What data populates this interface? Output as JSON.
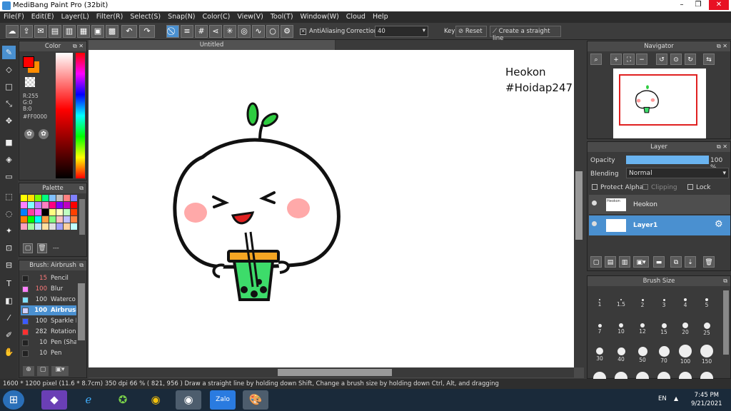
{
  "title_bar": {
    "title": "MediBang Paint Pro (32bit)",
    "minimize": "–",
    "restore": "❐",
    "close": "✕"
  },
  "menu": [
    "File(F)",
    "Edit(E)",
    "Layer(L)",
    "Filter(R)",
    "Select(S)",
    "Snap(N)",
    "Color(C)",
    "View(V)",
    "Tool(T)",
    "Window(W)",
    "Cloud",
    "Help"
  ],
  "toolbar": {
    "antialiasing_label": "AntiAliasing",
    "correction_label": "Correction",
    "correction_value": "40",
    "key_label": "Key",
    "reset_label": "Reset",
    "straight_line_label": "Create a straight line"
  },
  "color_panel": {
    "title": "Color",
    "r": "R:255",
    "g": "G:0",
    "b": "B:0",
    "hex": "#FF0000",
    "primary_color": "#ff0000",
    "secondary_color": "#ff8c00"
  },
  "palette_panel": {
    "title": "Palette",
    "footer_label": "---"
  },
  "brush_panel": {
    "title": "Brush: Airbrush",
    "items": [
      {
        "size": "15",
        "name": "Pencil",
        "color": "#222222",
        "num_color": "#ff7a7a"
      },
      {
        "size": "100",
        "name": "Blur",
        "color": "#ff80ff",
        "num_color": "#ff7a7a"
      },
      {
        "size": "100",
        "name": "Waterco",
        "color": "#80e0ff",
        "num_color": "#dddddd"
      },
      {
        "size": "100",
        "name": "Airbrush",
        "color": "#d0d0ff",
        "num_color": "#ffffff",
        "selected": true
      },
      {
        "size": "100",
        "name": "Sparkle B",
        "color": "#3a5aff",
        "num_color": "#dddddd"
      },
      {
        "size": "282",
        "name": "Rotation",
        "color": "#ff3030",
        "num_color": "#dddddd"
      },
      {
        "size": "10",
        "name": "Pen (Sha",
        "color": "#222222",
        "num_color": "#dddddd"
      },
      {
        "size": "10",
        "name": "Pen",
        "color": "#222222",
        "num_color": "#dddddd"
      }
    ]
  },
  "canvas": {
    "tab_title": "Untitled",
    "text_line1": "Heokon",
    "text_line2": "#Hoidap247"
  },
  "navigator": {
    "title": "Navigator"
  },
  "layer_panel": {
    "title": "Layer",
    "opacity_label": "Opacity",
    "opacity_value": "100 %",
    "opacity_percent": 100,
    "blending_label": "Blending",
    "blending_value": "Normal",
    "protect_alpha": "Protect Alpha",
    "clipping": "Clipping",
    "lock": "Lock",
    "layers": [
      {
        "name": "Heokon",
        "selected": false
      },
      {
        "name": "Layer1",
        "selected": true
      }
    ]
  },
  "brush_size": {
    "title": "Brush Size",
    "sizes": [
      "1",
      "1.5",
      "2",
      "3",
      "4",
      "5",
      "7",
      "10",
      "12",
      "15",
      "20",
      "25",
      "30",
      "40",
      "50",
      "70",
      "100",
      "150"
    ]
  },
  "status_bar": {
    "text": "1600 * 1200 pixel   (11.6 * 8.7cm)   350 dpi   66 %   ( 821, 956 )   Draw a straight line by holding down Shift, Change a brush size by holding down Ctrl, Alt, and dragging"
  },
  "taskbar": {
    "lang": "EN",
    "time": "7:45 PM",
    "date": "9/21/2021",
    "zalo_label": "Zalo"
  }
}
